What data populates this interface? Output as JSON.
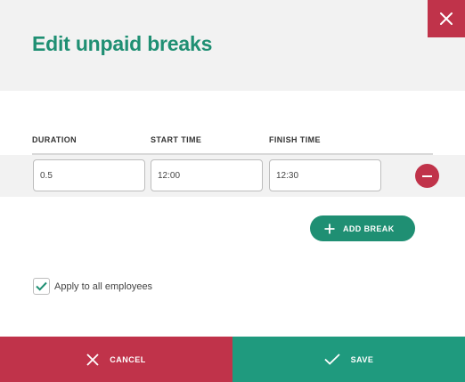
{
  "header": {
    "title": "Edit unpaid breaks"
  },
  "columns": {
    "duration": "DURATION",
    "start": "START TIME",
    "finish": "FINISH TIME"
  },
  "breaks": [
    {
      "duration": "0.5",
      "start_time": "12:00",
      "finish_time": "12:30"
    }
  ],
  "actions": {
    "add_break": "ADD BREAK",
    "apply_all_label": "Apply to all employees",
    "apply_all_checked": true,
    "cancel": "CANCEL",
    "save": "SAVE"
  },
  "colors": {
    "accent": "#1f8f73",
    "danger": "#c0334a",
    "header_bg": "#f2f2f2"
  },
  "icons": {
    "close": "close-icon",
    "remove": "minus-icon",
    "add": "plus-icon",
    "check": "check-icon",
    "cancel": "x-icon",
    "save": "checkmark-icon"
  }
}
